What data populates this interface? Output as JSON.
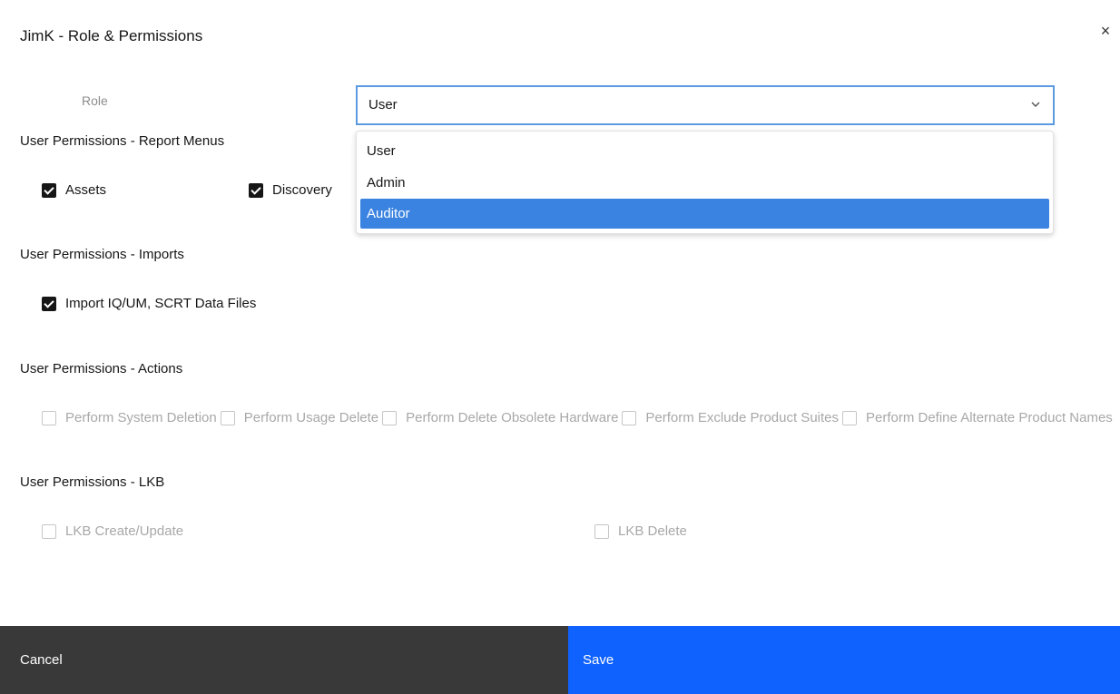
{
  "dialog": {
    "title": "JimK - Role & Permissions",
    "close_icon": "close-icon",
    "close_glyph": "×"
  },
  "role": {
    "label": "Role",
    "selected": "User",
    "options": [
      "User",
      "Admin",
      "Auditor"
    ],
    "highlighted_option": "Auditor",
    "chevron_icon": "chevron-down-icon"
  },
  "report_menus": {
    "heading": "User Permissions - Report Menus",
    "items": [
      {
        "label": "Assets",
        "checked": true,
        "disabled": false
      },
      {
        "label": "Discovery",
        "checked": true,
        "disabled": false
      }
    ]
  },
  "imports": {
    "heading": "User Permissions - Imports",
    "items": [
      {
        "label": "Import IQ/UM, SCRT Data Files",
        "checked": true,
        "disabled": false
      }
    ]
  },
  "actions": {
    "heading": "User Permissions - Actions",
    "items": [
      {
        "label": "Perform System Deletion",
        "checked": false,
        "disabled": true
      },
      {
        "label": "Perform Usage Delete",
        "checked": false,
        "disabled": true
      },
      {
        "label": "Perform Delete Obsolete Hardware",
        "checked": false,
        "disabled": true
      },
      {
        "label": "Perform Exclude Product Suites",
        "checked": false,
        "disabled": true
      },
      {
        "label": "Perform Define Alternate Product Names",
        "checked": false,
        "disabled": true
      }
    ]
  },
  "lkb": {
    "heading": "User Permissions - LKB",
    "items": [
      {
        "label": "LKB Create/Update",
        "checked": false,
        "disabled": true
      },
      {
        "label": "LKB Delete",
        "checked": false,
        "disabled": true
      }
    ]
  },
  "footer": {
    "cancel_label": "Cancel",
    "save_label": "Save"
  },
  "colors": {
    "primary": "#0f62fe",
    "secondary": "#393939",
    "option_highlight": "#3a83e0",
    "select_focus_border": "#5b9ae0",
    "disabled_text": "#a8a8a8"
  }
}
